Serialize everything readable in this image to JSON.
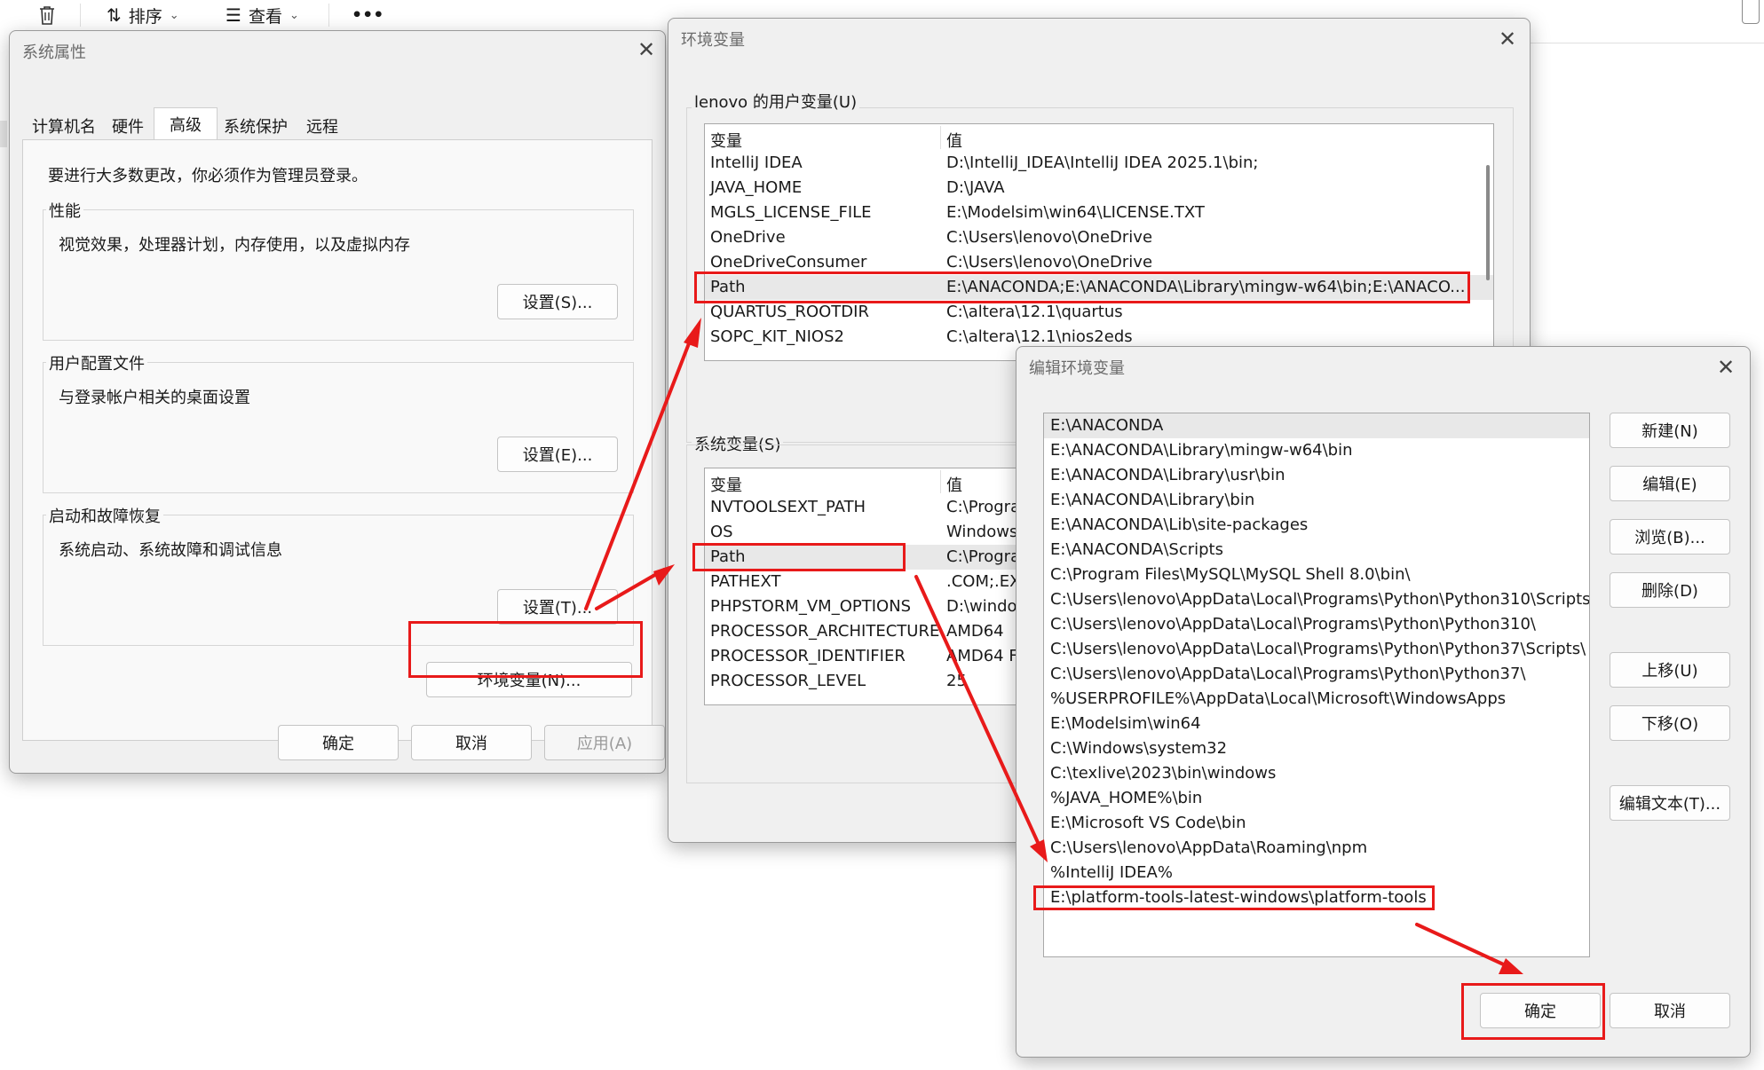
{
  "toolbar": {
    "sort_label": "排序",
    "view_label": "查看",
    "more_label": "•••"
  },
  "sysprops": {
    "title": "系统属性",
    "tabs": [
      "计算机名",
      "硬件",
      "高级",
      "系统保护",
      "远程"
    ],
    "admin_note": "要进行大多数更改，你必须作为管理员登录。",
    "performance": {
      "label": "性能",
      "desc": "视觉效果，处理器计划，内存使用，以及虚拟内存",
      "button": "设置(S)..."
    },
    "profile": {
      "label": "用户配置文件",
      "desc": "与登录帐户相关的桌面设置",
      "button": "设置(E)..."
    },
    "startup": {
      "label": "启动和故障恢复",
      "desc": "系统启动、系统故障和调试信息",
      "button": "设置(T)..."
    },
    "env_button": "环境变量(N)...",
    "ok": "确定",
    "cancel": "取消",
    "apply": "应用(A)"
  },
  "envvars": {
    "title": "环境变量",
    "user_label": "lenovo 的用户变量(U)",
    "sys_label": "系统变量(S)",
    "col_var": "变量",
    "col_val": "值",
    "user_rows": [
      {
        "name": "IntelliJ IDEA",
        "value": "D:\\IntelliJ_IDEA\\IntelliJ IDEA 2025.1\\bin;"
      },
      {
        "name": "JAVA_HOME",
        "value": "D:\\JAVA"
      },
      {
        "name": "MGLS_LICENSE_FILE",
        "value": "E:\\Modelsim\\win64\\LICENSE.TXT"
      },
      {
        "name": "OneDrive",
        "value": "C:\\Users\\lenovo\\OneDrive"
      },
      {
        "name": "OneDriveConsumer",
        "value": "C:\\Users\\lenovo\\OneDrive"
      },
      {
        "name": "Path",
        "value": "E:\\ANACONDA;E:\\ANACONDA\\Library\\mingw-w64\\bin;E:\\ANACO..."
      },
      {
        "name": "QUARTUS_ROOTDIR",
        "value": "C:\\altera\\12.1\\quartus"
      },
      {
        "name": "SOPC_KIT_NIOS2",
        "value": "C:\\altera\\12.1\\nios2eds"
      }
    ],
    "sys_rows": [
      {
        "name": "NVTOOLSEXT_PATH",
        "value": "C:\\Progra"
      },
      {
        "name": "OS",
        "value": "Windows"
      },
      {
        "name": "Path",
        "value": "C:\\Progra"
      },
      {
        "name": "PATHEXT",
        "value": ".COM;.EX"
      },
      {
        "name": "PHPSTORM_VM_OPTIONS",
        "value": "D:\\windo"
      },
      {
        "name": "PROCESSOR_ARCHITECTURE",
        "value": "AMD64"
      },
      {
        "name": "PROCESSOR_IDENTIFIER",
        "value": "AMD64 F"
      },
      {
        "name": "PROCESSOR_LEVEL",
        "value": "25"
      }
    ]
  },
  "editenv": {
    "title": "编辑环境变量",
    "paths": [
      "E:\\ANACONDA",
      "E:\\ANACONDA\\Library\\mingw-w64\\bin",
      "E:\\ANACONDA\\Library\\usr\\bin",
      "E:\\ANACONDA\\Library\\bin",
      "E:\\ANACONDA\\Lib\\site-packages",
      "E:\\ANACONDA\\Scripts",
      "C:\\Program Files\\MySQL\\MySQL Shell 8.0\\bin\\",
      "C:\\Users\\lenovo\\AppData\\Local\\Programs\\Python\\Python310\\Scripts\\",
      "C:\\Users\\lenovo\\AppData\\Local\\Programs\\Python\\Python310\\",
      "C:\\Users\\lenovo\\AppData\\Local\\Programs\\Python\\Python37\\Scripts\\",
      "C:\\Users\\lenovo\\AppData\\Local\\Programs\\Python\\Python37\\",
      "%USERPROFILE%\\AppData\\Local\\Microsoft\\WindowsApps",
      "E:\\Modelsim\\win64",
      "C:\\Windows\\system32",
      "C:\\texlive\\2023\\bin\\windows",
      "%JAVA_HOME%\\bin",
      "E:\\Microsoft VS Code\\bin",
      "C:\\Users\\lenovo\\AppData\\Roaming\\npm",
      "%IntelliJ IDEA%",
      "E:\\platform-tools-latest-windows\\platform-tools"
    ],
    "buttons": {
      "new": "新建(N)",
      "edit": "编辑(E)",
      "browse": "浏览(B)...",
      "delete": "删除(D)",
      "up": "上移(U)",
      "down": "下移(O)",
      "edit_text": "编辑文本(T)...",
      "ok": "确定",
      "cancel": "取消"
    }
  },
  "colors": {
    "highlight": "#e81a1a",
    "window_bg": "#f0f0f0",
    "list_bg": "#ffffff"
  }
}
